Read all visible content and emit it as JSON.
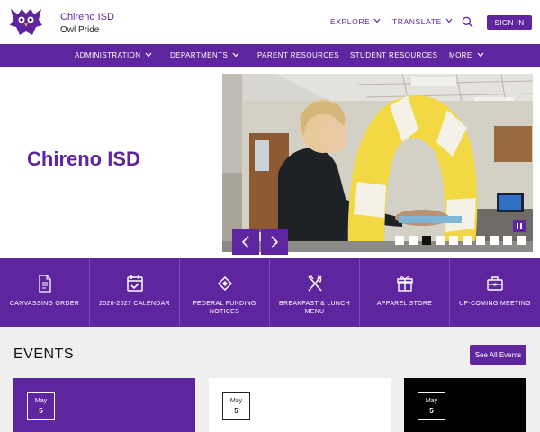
{
  "header": {
    "site_name": "Chireno ISD",
    "tagline": "Owl Pride",
    "explore": "EXPLORE",
    "translate": "TRANSLATE",
    "sign_in": "SIGN IN",
    "icons": [
      "owl-logo",
      "chevron-down-icon",
      "search-icon"
    ]
  },
  "nav": {
    "items": [
      {
        "label": "ADMINISTRATION",
        "dropdown": true
      },
      {
        "label": "DEPARTMENTS",
        "dropdown": true
      },
      {
        "label": "PARENT RESOURCES",
        "dropdown": false
      },
      {
        "label": "STUDENT RESOURCES",
        "dropdown": false
      },
      {
        "label": "MORE",
        "dropdown": true
      }
    ]
  },
  "hero": {
    "title": "Chireno ISD",
    "slide_count": 10,
    "active_slide": 3
  },
  "quick_links": [
    {
      "label": "CANVASSING ORDER",
      "icon": "document-icon"
    },
    {
      "label": "2026-2027 CALENDAR",
      "icon": "calendar-check-icon"
    },
    {
      "label": "FEDERAL FUNDING NOTICES",
      "icon": "ticket-icon"
    },
    {
      "label": "BREAKFAST & LUNCH MENU",
      "icon": "utensils-icon"
    },
    {
      "label": "APPAREL STORE",
      "icon": "gift-icon"
    },
    {
      "label": "UP-COMING MEETING",
      "icon": "briefcase-icon"
    }
  ],
  "events": {
    "title": "EVENTS",
    "see_all": "See All Events",
    "cards": [
      {
        "month": "May",
        "day": "5"
      },
      {
        "month": "May",
        "day": "5"
      },
      {
        "month": "May",
        "day": "5"
      }
    ]
  },
  "colors": {
    "brand": "#5f259f",
    "events_bg": "#efefef"
  }
}
